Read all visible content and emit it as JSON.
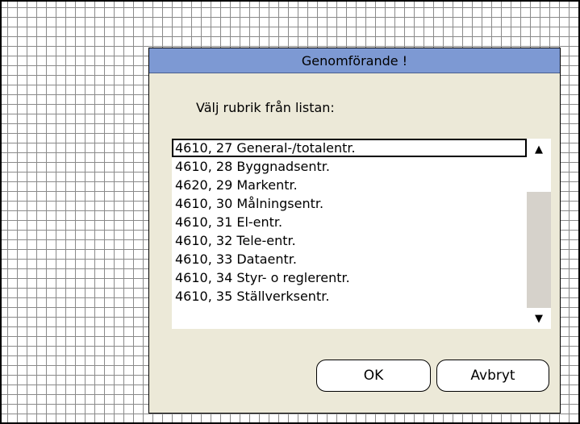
{
  "dialog": {
    "title": "Genomförande !",
    "prompt": "Välj rubrik från listan:",
    "list": {
      "selected_index": 0,
      "items": [
        "4610, 27 General-/totalentr.",
        "4610, 28 Byggnadsentr.",
        "4620, 29 Markentr.",
        "4610, 30 Målningsentr.",
        "4610, 31 El-entr.",
        "4610, 32 Tele-entr.",
        "4610, 33 Dataentr.",
        "4610, 34 Styr- o reglerentr.",
        "4610, 35 Ställverksentr."
      ]
    },
    "scroll_up_icon": "▲",
    "scroll_down_icon": "▼",
    "ok_label": "OK",
    "cancel_label": "Avbryt"
  },
  "colors": {
    "titlebar": "#7d99d3",
    "dialog_background": "#ece9d8",
    "grid_lines": "#8a8a8a"
  }
}
